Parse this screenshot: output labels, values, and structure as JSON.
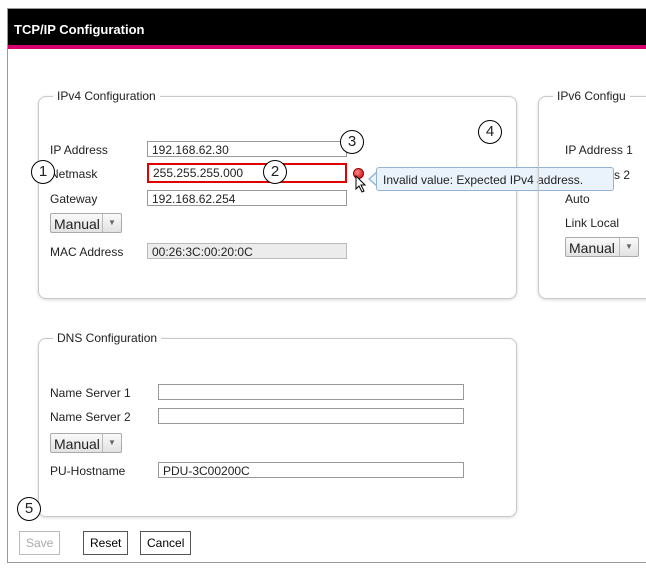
{
  "window": {
    "title": "TCP/IP Configuration"
  },
  "ipv4": {
    "legend": "IPv4 Configuration",
    "ip_label": "IP Address",
    "ip_value": "192.168.62.30",
    "netmask_label": "Netmask",
    "netmask_value": "255.255.255.000",
    "gateway_label": "Gateway",
    "gateway_value": "192.168.62.254",
    "mode_selected": "Manual",
    "mac_label": "MAC Address",
    "mac_value": "00:26:3C:00:20:0C"
  },
  "validation": {
    "tooltip": "Invalid value: Expected IPv4 address.",
    "error_color": "#e00000"
  },
  "ipv6": {
    "legend": "IPv6 Configu",
    "ip1_label": "IP Address 1",
    "ip2_label_fragment": "s 2",
    "auto_label": "Auto",
    "link_local_label": "Link Local",
    "mode_selected": "Manual"
  },
  "dns": {
    "legend": "DNS Configuration",
    "ns1_label": "Name Server 1",
    "ns1_value": "",
    "ns2_label": "Name Server 2",
    "ns2_value": "",
    "mode_selected": "Manual",
    "hostname_label": "PU-Hostname",
    "hostname_value": "PDU-3C00200C"
  },
  "buttons": {
    "save": "Save",
    "reset": "Reset",
    "cancel": "Cancel"
  },
  "callouts": {
    "c1": "1",
    "c2": "2",
    "c3": "3",
    "c4": "4",
    "c5": "5"
  },
  "colors": {
    "title_bar": "#000000",
    "accent": "#d6006f"
  }
}
